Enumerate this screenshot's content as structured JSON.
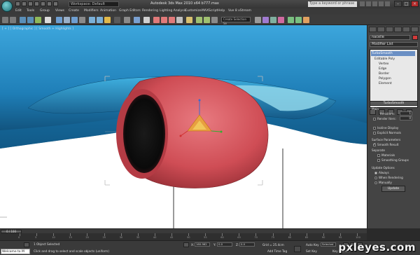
{
  "titlebar": {
    "workspace": "Workspace: Default",
    "title": "Autodesk 3ds Max 2010 x64    b777.max",
    "search_placeholder": "Type a keyword or phrase"
  },
  "menus": [
    "Edit",
    "Tools",
    "Group",
    "Views",
    "Create",
    "Modifiers",
    "Animation",
    "Graph Editors",
    "Rendering",
    "Lighting Analysis",
    "Customize",
    "MAXScript",
    "Help",
    "Vue 8 xStream"
  ],
  "toolbar": {
    "view_selector": "Create Selection Se"
  },
  "viewport": {
    "label": "[ + ] [ Orthographic ] [ Smooth + Highlights ]"
  },
  "command_panel": {
    "object_name": "nacelle",
    "modifier_list": "Modifier List",
    "stack": [
      {
        "label": "TurboSmooth",
        "selected": true,
        "sub": false
      },
      {
        "label": "Editable Poly",
        "selected": false,
        "sub": false
      },
      {
        "label": "Vertex",
        "selected": false,
        "sub": true
      },
      {
        "label": "Edge",
        "selected": false,
        "sub": true
      },
      {
        "label": "Border",
        "selected": false,
        "sub": true
      },
      {
        "label": "Polygon",
        "selected": false,
        "sub": true
      },
      {
        "label": "Element",
        "selected": false,
        "sub": true
      }
    ],
    "rollout_title": "TurboSmooth",
    "main_label": "Main",
    "iterations_label": "Iterations:",
    "iterations_value": "1",
    "render_iters_label": "Render Iters:",
    "render_iters_value": "0",
    "isoline_label": "Isoline Display",
    "explicit_label": "Explicit Normals",
    "surface_label": "Surface Parameters",
    "smooth_result_label": "Smooth Result",
    "separate_label": "Separate",
    "materials_label": "Materials",
    "smoothing_groups_label": "Smoothing Groups",
    "update_options_label": "Update Options",
    "always_label": "Always",
    "when_rendering_label": "When Rendering",
    "manually_label": "Manually",
    "update_button": "Update"
  },
  "timeline": {
    "slider_label": "0 / 100",
    "ticks": [
      "0",
      "5",
      "10",
      "15",
      "20",
      "25",
      "30",
      "35",
      "40",
      "45",
      "50",
      "55",
      "60",
      "65",
      "70",
      "75",
      "80",
      "85",
      "90",
      "95",
      "100"
    ]
  },
  "statusbar": {
    "maxscript": "Welcome to M",
    "selection": "1 Object Selected",
    "prompt": "Click and drag to select and scale objects (uniform)",
    "x_label": "X:",
    "x_value": "160.962",
    "y_label": "Y:",
    "y_value": "0.0",
    "z_label": "Z:",
    "z_value": "0.0",
    "grid": "Grid = 25.4cm",
    "auto_key": "Auto Key",
    "selected": "Selected",
    "set_key": "Set Key",
    "key_filters": "Key Filters...",
    "add_time_tag": "Add Time Tag"
  },
  "watermark": "pxleyes.com",
  "colors": {
    "nacelle": "#d4555c",
    "wing": "#2a8fc9",
    "sky": "#ffffff",
    "ui_bg": "#3c3c3c"
  }
}
